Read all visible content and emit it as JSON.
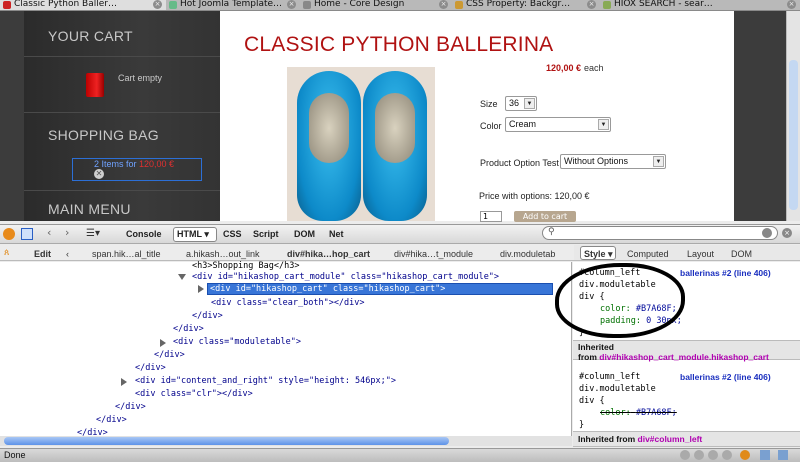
{
  "tabs": [
    {
      "label": "Classic Python Baller…",
      "active": true
    },
    {
      "label": "Hot Joomla Template…",
      "active": false
    },
    {
      "label": "Home - Core Design",
      "active": false
    },
    {
      "label": "CSS Property: Backgr…",
      "active": false
    },
    {
      "label": "HIOX SEARCH - sear…",
      "active": false
    }
  ],
  "sidebar": {
    "your_cart": "YOUR CART",
    "cart_empty": "Cart empty",
    "shopping_bag": "SHOPPING BAG",
    "bag_items": "2 Items for ",
    "bag_price": "120,00 €",
    "main_menu": "MAIN MENU"
  },
  "product": {
    "title": "CLASSIC PYTHON BALLERINA",
    "price": "120,00 €",
    "price_suffix": "each",
    "size_label": "Size",
    "size_value": "36",
    "color_label": "Color",
    "color_value": "Cream",
    "option_label": "Product Option Test",
    "option_value": "Without Options",
    "price_with_options": "Price with options: 120,00 €",
    "qty": "1",
    "add_to_cart": "Add to cart"
  },
  "firebug": {
    "toolbar": {
      "console": "Console",
      "html": "HTML",
      "css": "CSS",
      "script": "Script",
      "dom": "DOM",
      "net": "Net"
    },
    "edit": "Edit",
    "breadcrumbs": [
      "span.hik…al_title",
      "a.hikash…out_link",
      "div#hika…hop_cart",
      "div#hika…t_module",
      "div.moduletab"
    ],
    "side_tabs": {
      "style": "Style",
      "computed": "Computed",
      "layout": "Layout",
      "dom": "DOM"
    },
    "html_lines": [
      {
        "t": "<h3>Shopping Bag</h3>"
      },
      {
        "t": "<div id=\"hikashop_cart_module\" class=\"hikashop_cart_module\">"
      },
      {
        "t": "<div id=\"hikashop_cart\" class=\"hikashop_cart\">"
      },
      {
        "t": "<div class=\"clear_both\"></div>"
      },
      {
        "t": "</div>"
      },
      {
        "t": "</div>"
      },
      {
        "t": "<div class=\"moduletable\">"
      },
      {
        "t": "</div>"
      },
      {
        "t": "</div>"
      },
      {
        "t": "<div id=\"content_and_right\" style=\"height: 546px;\">"
      },
      {
        "t": "<div class=\"clr\"></div>"
      },
      {
        "t": "</div>"
      },
      {
        "t": "</div>"
      },
      {
        "t": "</div>"
      }
    ],
    "rule1": {
      "sel1": "#column_left",
      "sel2": "div.moduletable",
      "sel3": "div {",
      "prop1": "color:",
      "val1": "#B7A68F;",
      "prop2": "padding:",
      "val2": "0 30px;",
      "close": "}",
      "source": "ballerinas #2 (line 406)"
    },
    "inherited1": {
      "label": "Inherited",
      "from": "from ",
      "sel": "div#hikashop_cart_module.hikashop_cart"
    },
    "rule2": {
      "sel1": "#column_left",
      "sel2": "div.moduletable",
      "sel3": "div {",
      "prop1": "color:",
      "val1": "#B7A68F;",
      "close": "}",
      "source": "ballerinas #2 (line 406)"
    },
    "inherited2": {
      "label": "Inherited from ",
      "sel": "div#column_left"
    }
  },
  "status": {
    "text": "Done"
  },
  "colors": {
    "accent": "#B7A68F",
    "title_red": "#B01212",
    "selection": "#3875D7"
  }
}
